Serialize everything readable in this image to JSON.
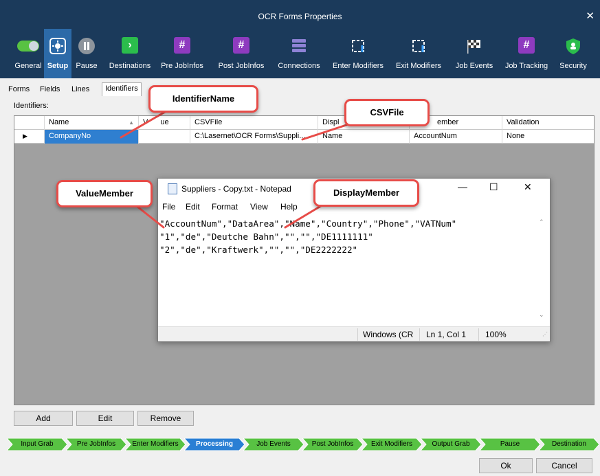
{
  "window": {
    "title": "OCR Forms Properties",
    "close": "✕"
  },
  "toolbar": {
    "items": [
      {
        "label": "General"
      },
      {
        "label": "Setup"
      },
      {
        "label": "Pause"
      },
      {
        "label": "Destinations"
      },
      {
        "label": "Pre JobInfos"
      },
      {
        "label": "Post JobInfos"
      },
      {
        "label": "Connections"
      },
      {
        "label": "Enter Modifiers"
      },
      {
        "label": "Exit Modifiers"
      },
      {
        "label": "Job Events"
      },
      {
        "label": "Job Tracking"
      },
      {
        "label": "Security"
      }
    ]
  },
  "tabs": [
    {
      "label": "Forms"
    },
    {
      "label": "Fields"
    },
    {
      "label": "Lines"
    },
    {
      "label": "Identifiers"
    },
    {
      "label": "S"
    }
  ],
  "identifiers_label": "Identifiers:",
  "grid": {
    "columns": [
      "Name",
      "Value",
      "CSVFile",
      "Display",
      "ValueMember",
      "Validation"
    ],
    "header_visible": [
      "Name",
      "V",
      "ue",
      "CSVFile",
      "Displ",
      "ember",
      "Validation"
    ],
    "rows": [
      {
        "name": "CompanyNo",
        "value": "",
        "csvfile": "C:\\Lasernet\\OCR Forms\\Suppli...",
        "display": "Name",
        "valuemember": "AccountNum",
        "validation": "None"
      }
    ]
  },
  "notepad": {
    "title": "Suppliers - Copy.txt - Notepad",
    "menu": [
      "File",
      "Edit",
      "Format",
      "View",
      "Help"
    ],
    "lines": [
      "\"AccountNum\",\"DataArea\",\"Name\",\"Country\",\"Phone\",\"VATNum\"",
      "\"1\",\"de\",\"Deutche Bahn\",\"\",\"\",\"DE1111111\"",
      "\"2\",\"de\",\"Kraftwerk\",\"\",\"\",\"DE2222222\""
    ],
    "status": {
      "encoding": "Windows (CR",
      "position": "Ln 1, Col 1",
      "zoom": "100%"
    },
    "controls": {
      "minimize": "—",
      "maximize": "☐",
      "close": "✕"
    }
  },
  "callouts": {
    "identifier_name": "IdentifierName",
    "csv_file": "CSVFile",
    "value_member": "ValueMember",
    "display_member": "DisplayMember"
  },
  "buttons": {
    "add": "Add",
    "edit": "Edit",
    "remove": "Remove",
    "ok": "Ok",
    "cancel": "Cancel"
  },
  "process_steps": [
    {
      "label": "Input Grab",
      "active": false
    },
    {
      "label": "Pre JobInfos",
      "active": false
    },
    {
      "label": "Enter Modifiers",
      "active": false
    },
    {
      "label": "Processing",
      "active": true
    },
    {
      "label": "Job Events",
      "active": false
    },
    {
      "label": "Post JobInfos",
      "active": false
    },
    {
      "label": "Exit Modifiers",
      "active": false
    },
    {
      "label": "Output Grab",
      "active": false
    },
    {
      "label": "Pause",
      "active": false
    },
    {
      "label": "Destination",
      "active": false
    }
  ],
  "colors": {
    "title_bar": "#1b3a5b",
    "toolbar_active": "#2c6aa8",
    "selection": "#2f7fd0",
    "callout_border": "#e74c48",
    "step_green": "#58c243",
    "step_active": "#2a7fd4"
  }
}
